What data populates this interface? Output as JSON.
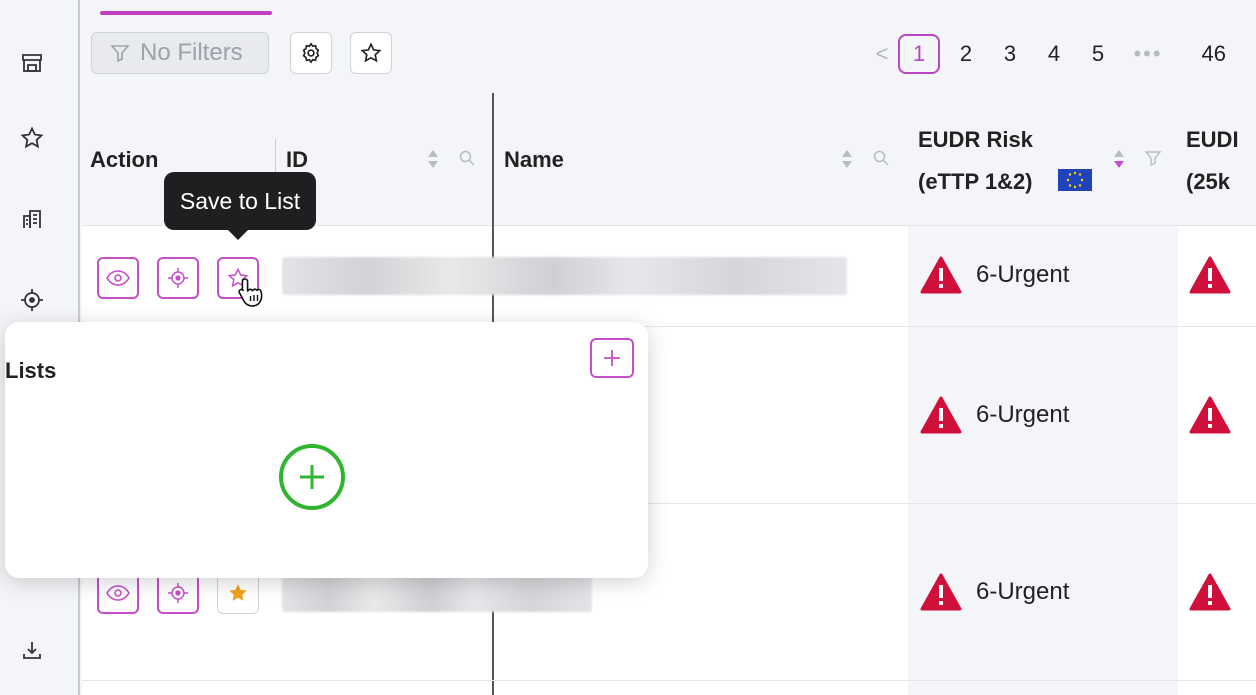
{
  "sidebar": {
    "icons": [
      "store-icon",
      "star-icon",
      "building-icon",
      "target-icon",
      "download-icon"
    ]
  },
  "toolbar": {
    "filter_label": "No Filters",
    "settings_icon": "gear-icon",
    "favorite_icon": "star-icon"
  },
  "pagination": {
    "prev": "<",
    "pages": [
      "1",
      "2",
      "3",
      "4",
      "5"
    ],
    "active_page": "1",
    "ellipsis": "•••",
    "last_page": "46"
  },
  "table": {
    "columns": {
      "action": "Action",
      "id": "ID",
      "name": "Name",
      "eudr_line1": "EUDR Risk",
      "eudr_line2": "(eTTP 1&2)",
      "eudr2_line1": "EUDI",
      "eudr2_line2": "(25k"
    },
    "rows": [
      {
        "risk": "6-Urgent"
      },
      {
        "risk": "6-Urgent"
      },
      {
        "risk": "6-Urgent"
      }
    ]
  },
  "tooltip": {
    "text": "Save to List"
  },
  "popover": {
    "title": "Lists"
  },
  "colors": {
    "accent": "#c54ec9",
    "urgent": "#d0103a",
    "create": "#2fb52f",
    "starred": "#f0a31c"
  }
}
